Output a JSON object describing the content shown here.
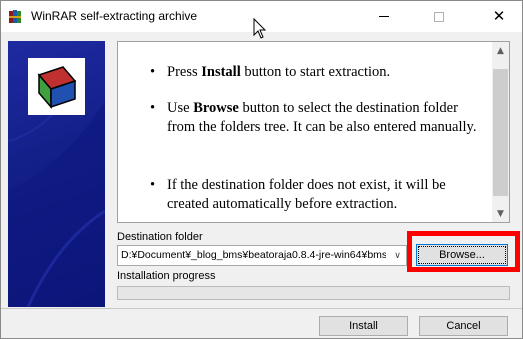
{
  "window": {
    "title": "WinRAR self-extracting archive",
    "close_glyph": "✕"
  },
  "icons": {
    "app": "winrar-books-icon",
    "banner": "winrar-logo-icon",
    "minimize": "minimize-icon",
    "maximize": "maximize-icon",
    "close": "close-icon",
    "cursor": "mouse-cursor-icon",
    "scroll_up": "chevron-up-icon",
    "scroll_down": "chevron-down-icon",
    "combo": "chevron-down-icon"
  },
  "instructions": {
    "bullet_glyph": "•",
    "items": [
      {
        "pre": "Press ",
        "bold": "Install",
        "post": " button to start extraction."
      },
      {
        "pre": "Use ",
        "bold": "Browse",
        "post": " button to select the destination folder from the folders tree. It can be also entered manually."
      },
      {
        "pre": "",
        "bold": "",
        "post": "If the destination folder does not exist, it will be created automatically before extraction."
      }
    ]
  },
  "scroll_glyphs": {
    "up": "▲",
    "down": "▼"
  },
  "destination": {
    "label": "Destination folder",
    "value": "D:¥Document¥_blog_bms¥beatoraja0.8.4-jre-win64¥bms",
    "arrow_glyph": "∨"
  },
  "browse_button": {
    "label": "Browse..."
  },
  "progress": {
    "label": "Installation progress",
    "fraction": 0
  },
  "buttons": {
    "install_label": "Install",
    "cancel_label": "Cancel"
  },
  "colors": {
    "highlight": "#ff0000",
    "banner_blue": "#14208a",
    "focus_border": "#0078d7"
  }
}
